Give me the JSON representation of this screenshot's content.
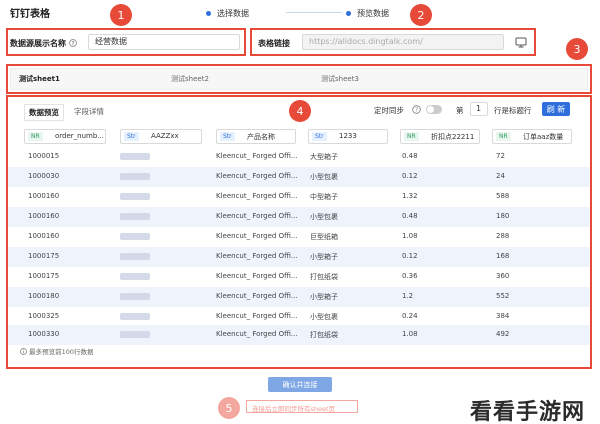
{
  "app": {
    "title": "钉钉表格"
  },
  "stepper": {
    "steps": [
      "选择数据",
      "预览数据"
    ],
    "accent": "#2f6fdb"
  },
  "badges": [
    "1",
    "2",
    "3",
    "4",
    "5"
  ],
  "form": {
    "display_name_label": "数据源展示名称",
    "display_name_value": "经营数据",
    "table_link_label": "表格链接",
    "table_link_placeholder": "https://alidocs.dingtalk.com/"
  },
  "sheet_tabs": [
    "测试sheet1",
    "测试sheet2",
    "测试sheet3"
  ],
  "panel": {
    "tabs": [
      "数据预览",
      "字段详情"
    ],
    "schedule_label": "定时同步",
    "row_prefix": "第",
    "row_value": "1",
    "row_suffix": "行是标题行",
    "refresh_label": "刷 新",
    "footnote": "最多预览前100行数据"
  },
  "table": {
    "columns": [
      {
        "type": "NR",
        "name": "order_numb..."
      },
      {
        "type": "Str",
        "name": "AAZZxx"
      },
      {
        "type": "Str",
        "name": "产品名称"
      },
      {
        "type": "Str",
        "name": "1233"
      },
      {
        "type": "NR",
        "name": "折扣点22211"
      },
      {
        "type": "NR",
        "name": "订单aaz数量"
      }
    ],
    "rows": [
      [
        "1000015",
        "",
        "Kleencut_ Forged Offi...",
        "大型箱子",
        "0.48",
        "72"
      ],
      [
        "1000030",
        "",
        "Kleencut_ Forged Offi...",
        "小型包裹",
        "0.12",
        "24"
      ],
      [
        "1000160",
        "",
        "Kleencut_ Forged Offi...",
        "中型箱子",
        "1.32",
        "588"
      ],
      [
        "1000160",
        "",
        "Kleencut_ Forged Offi...",
        "小型包裹",
        "0.48",
        "180"
      ],
      [
        "1000160",
        "",
        "Kleencut_ Forged Offi...",
        "巨型纸箱",
        "1.08",
        "288"
      ],
      [
        "1000175",
        "",
        "Kleencut_ Forged Offi...",
        "小型箱子",
        "0.12",
        "168"
      ],
      [
        "1000175",
        "",
        "Kleencut_ Forged Offi...",
        "打包纸袋",
        "0.36",
        "360"
      ],
      [
        "1000180",
        "",
        "Kleencut_ Forged Offi...",
        "小型箱子",
        "1.2",
        "552"
      ],
      [
        "1000325",
        "",
        "Kleencut_ Forged Offi...",
        "小型包裹",
        "0.24",
        "384"
      ],
      [
        "1000330",
        "",
        "Kleencut_ Forged Offi...",
        "打包纸袋",
        "1.08",
        "492"
      ]
    ]
  },
  "actions": {
    "confirm_label": "确认并连接",
    "sync_link": "连接后立即同步所有sheet页"
  },
  "watermark": "看看手游网",
  "colors": {
    "highlight": "#e84a3a",
    "primary": "#2f6fdb"
  }
}
